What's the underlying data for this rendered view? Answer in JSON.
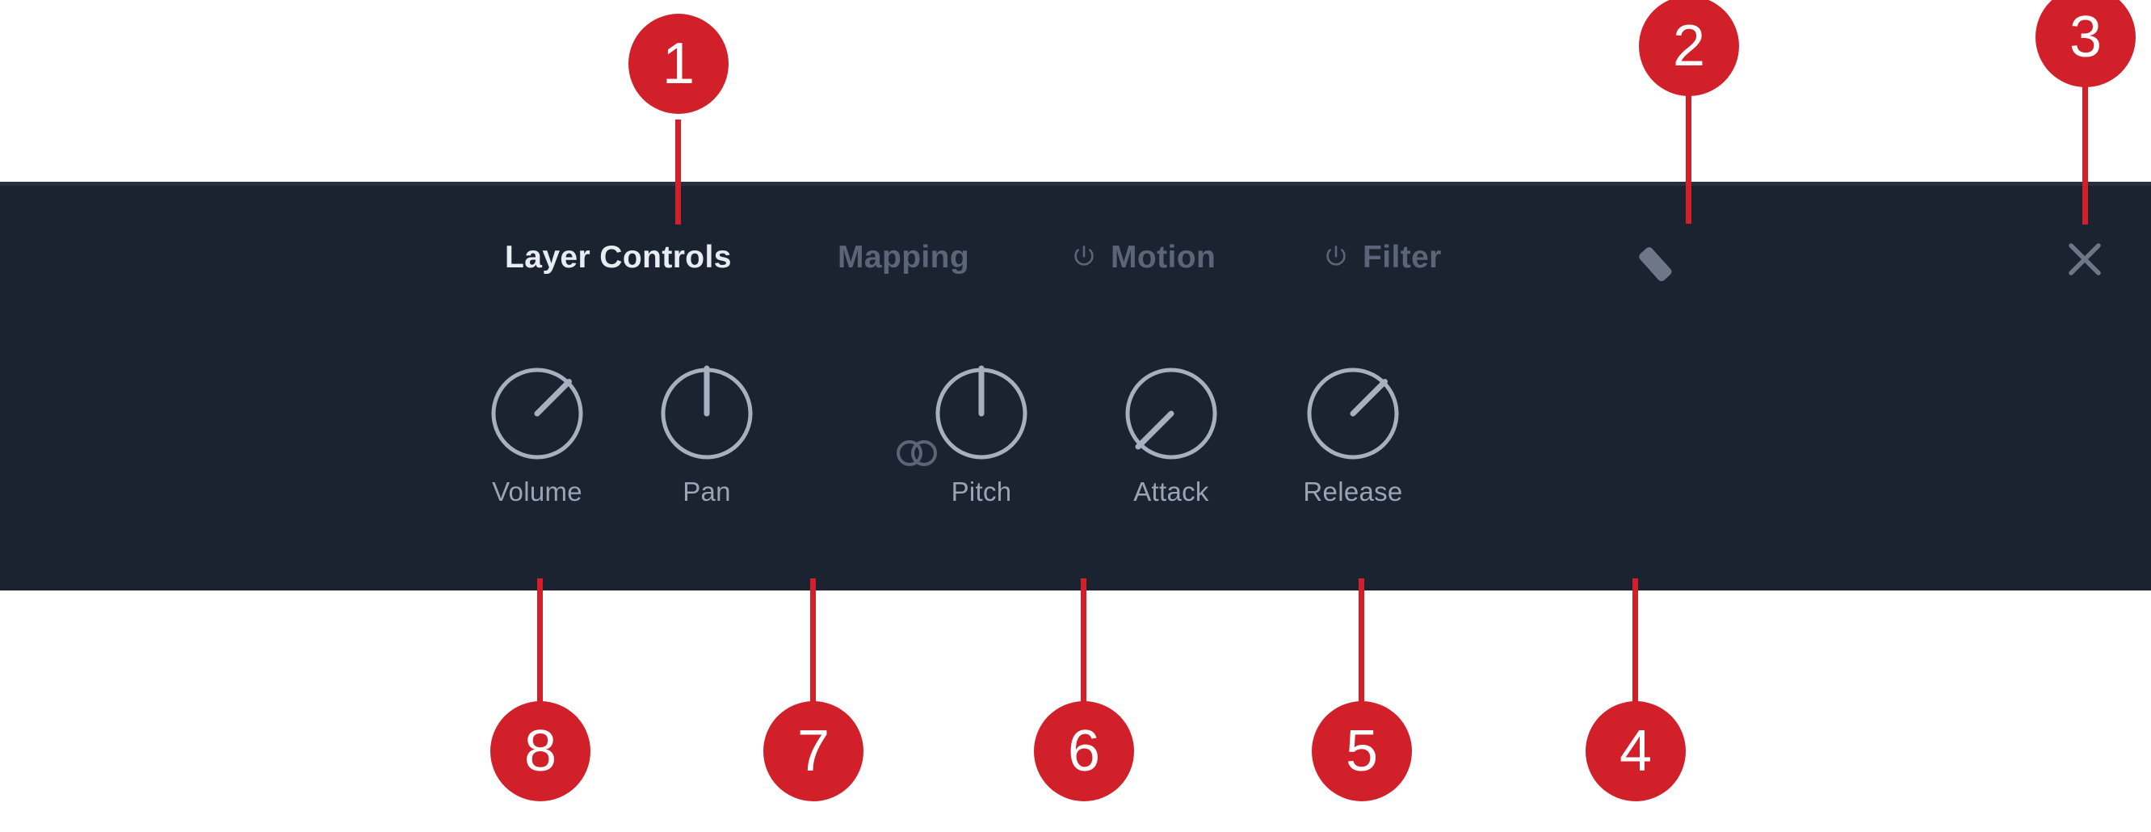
{
  "panel": {
    "background_color": "#1b2331",
    "border_color": "#253142",
    "accent_color": "#d2202a"
  },
  "header": {
    "tabs": [
      {
        "label": "Layer Controls",
        "active": true,
        "has_power_icon": false,
        "icon": ""
      },
      {
        "label": "Mapping",
        "active": false,
        "has_power_icon": false,
        "icon": ""
      },
      {
        "label": "Motion",
        "active": false,
        "has_power_icon": true,
        "icon": "power-icon"
      },
      {
        "label": "Filter",
        "active": false,
        "has_power_icon": true,
        "icon": "power-icon"
      }
    ],
    "actions": [
      {
        "name": "eraser-button",
        "icon": "eraser-icon"
      },
      {
        "name": "close-button",
        "icon": "close-icon"
      }
    ]
  },
  "controls": {
    "link_icon": "link-icon",
    "knobs": [
      {
        "label": "Volume",
        "angle": 47,
        "icon": "knob-volume"
      },
      {
        "label": "Pan",
        "angle": 0,
        "icon": "knob-pan"
      },
      {
        "label": "Pitch",
        "angle": 0,
        "icon": "knob-pitch"
      },
      {
        "label": "Attack",
        "angle": -133,
        "icon": "knob-attack"
      },
      {
        "label": "Release",
        "angle": 47,
        "icon": "knob-release"
      }
    ]
  },
  "annotations": {
    "callouts": [
      {
        "number": "1",
        "target": "Layer Controls tab"
      },
      {
        "number": "2",
        "target": "Eraser / clear button"
      },
      {
        "number": "3",
        "target": "Close panel button"
      },
      {
        "number": "4",
        "target": "Release knob"
      },
      {
        "number": "5",
        "target": "Attack knob"
      },
      {
        "number": "6",
        "target": "Pitch knob"
      },
      {
        "number": "7",
        "target": "Pan knob"
      },
      {
        "number": "8",
        "target": "Volume knob"
      }
    ]
  }
}
